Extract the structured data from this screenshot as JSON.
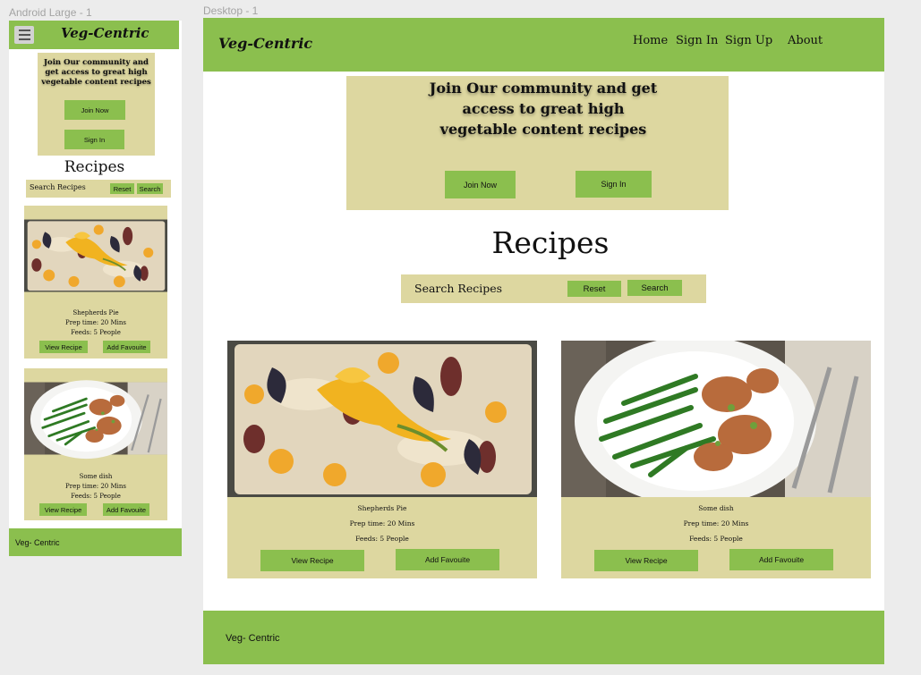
{
  "frames": {
    "mobile_label": "Android Large - 1",
    "desktop_label": "Desktop - 1"
  },
  "brand": "Veg-Centric",
  "colors": {
    "accent": "#8bbf4e",
    "panel": "#ddd7a0"
  },
  "nav": [
    {
      "label": "Home"
    },
    {
      "label": "Sign In"
    },
    {
      "label": "Sign Up"
    },
    {
      "label": "About"
    }
  ],
  "join": {
    "title": "Join Our community and get access to great high vegetable content recipes",
    "join_label": "Join Now",
    "signin_label": "Sign In"
  },
  "recipes_heading": "Recipes",
  "search": {
    "label": "Search Recipes",
    "reset_label": "Reset",
    "search_label": "Search"
  },
  "cards": [
    {
      "name": "Shepherds Pie",
      "prep": "Prep time: 20 Mins",
      "feeds": "Feeds: 5 People",
      "view_label": "View Recipe",
      "fav_label": "Add Favouite",
      "image": "focaccia-flowers-photo"
    },
    {
      "name": "Some dish",
      "prep": "Prep time: 20 Mins",
      "feeds": "Feeds: 5 People",
      "view_label": "View Recipe",
      "fav_label": "Add Favouite",
      "image": "green-beans-chicken-photo"
    }
  ],
  "footer": "Veg- Centric",
  "icons": {
    "menu": "hamburger-icon"
  }
}
